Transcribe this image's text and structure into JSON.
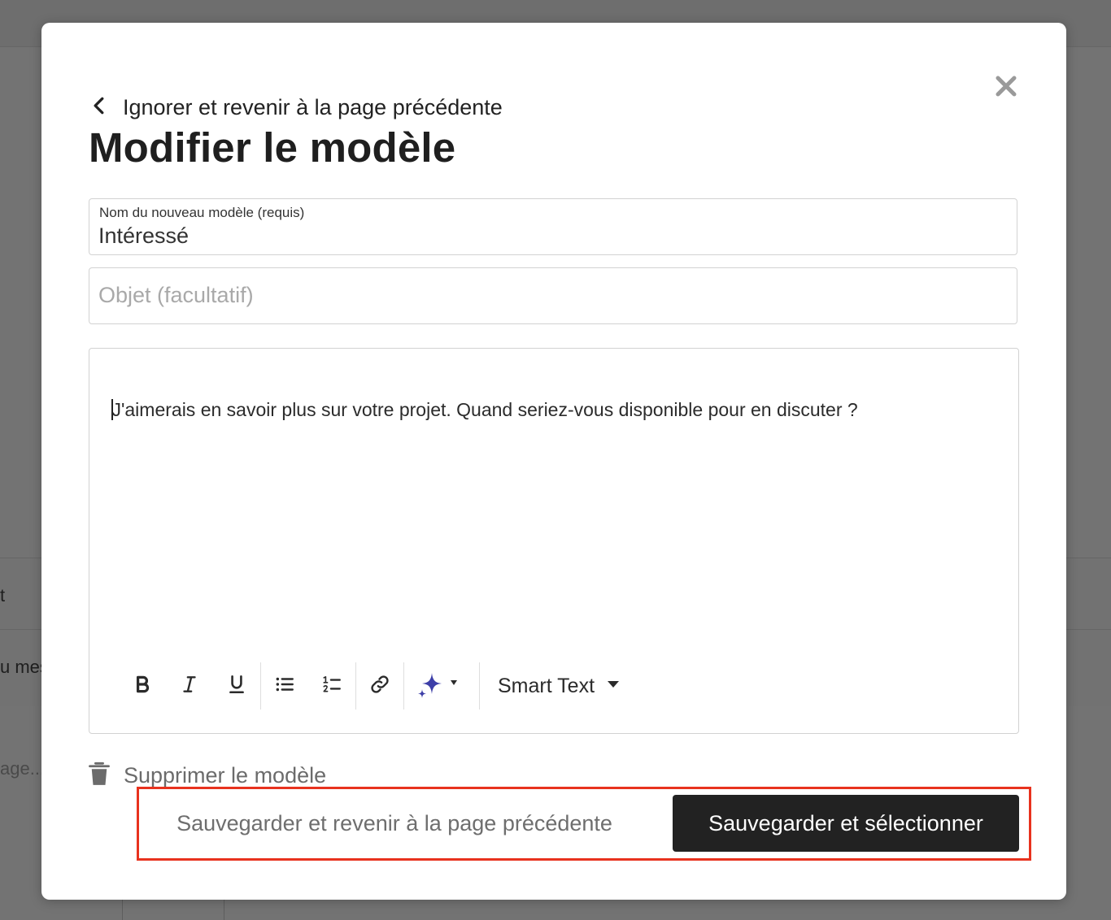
{
  "background": {
    "row1_text": "t",
    "row2_text": "u mes",
    "composer_placeholder": "age..."
  },
  "modal": {
    "back_label": "Ignorer et revenir à la page précédente",
    "title": "Modifier le modèle",
    "name_field": {
      "label": "Nom du nouveau modèle (requis)",
      "value": "Intéressé"
    },
    "subject_field": {
      "placeholder": "Objet (facultatif)",
      "value": ""
    },
    "editor": {
      "body": "J'aimerais en savoir plus sur votre projet. Quand seriez-vous disponible pour en discuter ?",
      "smart_text_label": "Smart Text",
      "ai_color": "#3d3fa8"
    },
    "delete_label": "Supprimer le modèle",
    "save_back_label": "Sauvegarder et revenir à la page précédente",
    "save_select_label": "Sauvegarder et sélectionner",
    "highlight_color": "#e8321e"
  }
}
